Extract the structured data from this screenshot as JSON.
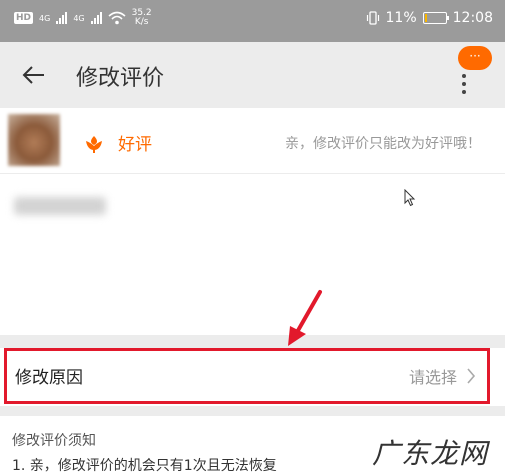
{
  "status_bar": {
    "hd": "HD",
    "net1": "4G",
    "net2": "4G",
    "speed_value": "35.2",
    "speed_unit": "K/s",
    "battery": "11%",
    "battery_level": 0.11,
    "time": "12:08"
  },
  "app_bar": {
    "title": "修改评价",
    "badge": "···"
  },
  "rating": {
    "label": "好评",
    "hint": "亲，修改评价只能改为好评哦！"
  },
  "reason": {
    "label": "修改原因",
    "value": "请选择"
  },
  "notice": {
    "title": "修改评价须知",
    "item1": "1. 亲，修改评价的机会只有1次且无法恢复"
  },
  "watermark": "广东龙网",
  "colors": {
    "accent": "#ff6a00",
    "highlight": "#e2192c",
    "status_bar": "#9b9b9b",
    "app_bar": "#ececec"
  },
  "icons": {
    "back": "arrow-left-icon",
    "more": "more-vertical-icon",
    "rating": "flower-icon",
    "chevron": "chevron-right-icon",
    "cursor": "mouse-pointer-icon"
  }
}
